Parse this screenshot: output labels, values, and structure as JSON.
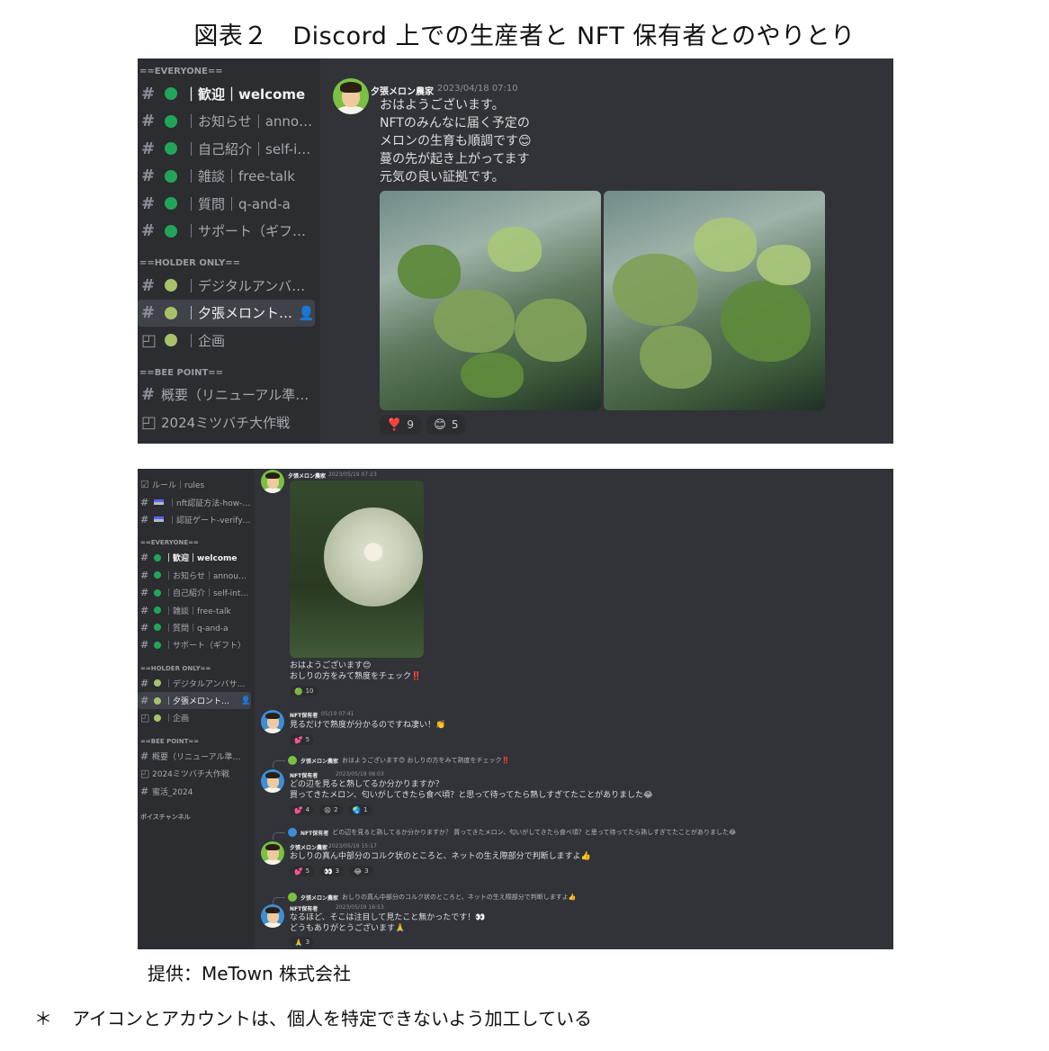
{
  "figure": {
    "title": "図表２　Discord 上での生産者と NFT 保有者とのやりとり",
    "credit": "提供：MeTown 株式会社",
    "note_mark": "＊",
    "note": "アイコンとアカウントは、個人を特定できないよう加工している"
  },
  "colors": {
    "background": "#313338",
    "sidebar": "#2b2d31",
    "online": "#23a559",
    "holder": "#a8c26c",
    "nft_avatar": "#3c8fd6",
    "farmer_avatar": "#7ac142"
  },
  "panel1": {
    "sidebar": {
      "categories": [
        "==EVERYONE==",
        "==HOLDER ONLY==",
        "==BEE POINT=="
      ],
      "everyone": [
        "｜歓迎｜welcome",
        "｜お知らせ｜announ…",
        "｜自己紹介｜self-int…",
        "｜雑談｜free-talk",
        "｜質問｜q-and-a",
        "｜サポート（ギフト）"
      ],
      "holder": [
        "｜デジタルアンバサ…",
        "｜夕張メロントー…",
        "｜企画"
      ],
      "bee": [
        "概要（リニューアル準…",
        "2024ミツバチ大作戦"
      ]
    },
    "message": {
      "author": "夕張メロン農家",
      "timestamp": "2023/04/18 07:10",
      "lines": [
        "おはようございます。",
        "NFTのみんなに届く予定の",
        "メロンの生育も順調です😊",
        "蔓の先が起き上がってます",
        "元気の良い証拠です。"
      ],
      "reactions": [
        {
          "icon": "❣️",
          "count": "9"
        },
        {
          "icon": "😊",
          "count": "5"
        }
      ]
    }
  },
  "panel2": {
    "sidebar": {
      "top": [
        "ルール｜rules",
        "｜nft認証方法-how-t…",
        "｜認証ゲート-verify-…"
      ],
      "categories": [
        "==EVERYONE==",
        "==HOLDER ONLY==",
        "==BEE POINT==",
        "ボイスチャンネル"
      ],
      "everyone": [
        "｜歓迎｜welcome",
        "｜お知らせ｜announ…",
        "｜自己紹介｜self-int…",
        "｜雑談｜free-talk",
        "｜質問｜q-and-a",
        "｜サポート（ギフト）"
      ],
      "holder": [
        "｜デジタルアンバサ…",
        "｜夕張メロントー…",
        "｜企画"
      ],
      "bee": [
        "概要（リニューアル準…",
        "2024ミツバチ大作戦",
        "蜜活_2024"
      ]
    },
    "messages": [
      {
        "author": "夕張メロン農家",
        "timestamp": "2023/05/19 07:23",
        "lines": [
          "おはようございます😊",
          "おしりの方をみて熟度をチェック‼️"
        ],
        "reactions": [
          {
            "icon": "🟢",
            "count": "10"
          }
        ]
      },
      {
        "author": "NFT保有者",
        "timestamp": "05/19 07:41",
        "lines": [
          "見るだけで熟度が分かるのですね凄い！👏"
        ],
        "reactions": [
          {
            "icon": "💕",
            "count": "5"
          }
        ]
      },
      {
        "reply_author": "夕張メロン農家",
        "reply_text": "おはようございます😊 おしりの方をみて熟度をチェック‼️",
        "author": "NFT保有者",
        "timestamp": "2023/05/19 08:03",
        "lines": [
          "どの辺を見ると熟してるか分かりますか？",
          "買ってきたメロン、匂いがしてきたら食べ頃？と思って待ってたら熟しすぎてたことがありました😂"
        ],
        "reactions": [
          {
            "icon": "💕",
            "count": "4"
          },
          {
            "icon": "😫",
            "count": "2"
          },
          {
            "icon": "🌏",
            "count": "1"
          }
        ]
      },
      {
        "reply_author": "NFT保有者",
        "reply_text": "どの辺を見ると熟してるか分かりますか？ 買ってきたメロン、匂いがしてきたら食べ頃？と思って待ってたら熟しすぎてたことがありました😂",
        "author": "夕張メロン農家",
        "timestamp": "2023/05/19 15:17",
        "lines": [
          "おしりの真ん中部分のコルク状のところと、ネットの生え際部分で判断しますよ👍"
        ],
        "reactions": [
          {
            "icon": "💕",
            "count": "5"
          },
          {
            "icon": "👀",
            "count": "3"
          },
          {
            "icon": "😂",
            "count": "3"
          }
        ]
      },
      {
        "reply_author": "夕張メロン農家",
        "reply_text": "おしりの真ん中部分のコルク状のところと、ネットの生え際部分で判断しますよ👍",
        "author": "NFT保有者",
        "timestamp": "2023/05/19 16:53",
        "lines": [
          "なるほど、そこは注目して見たこと無かったです！👀",
          "どうもありがとうございます🙏"
        ],
        "reactions": [
          {
            "icon": "🙏",
            "count": "3"
          }
        ]
      }
    ]
  }
}
